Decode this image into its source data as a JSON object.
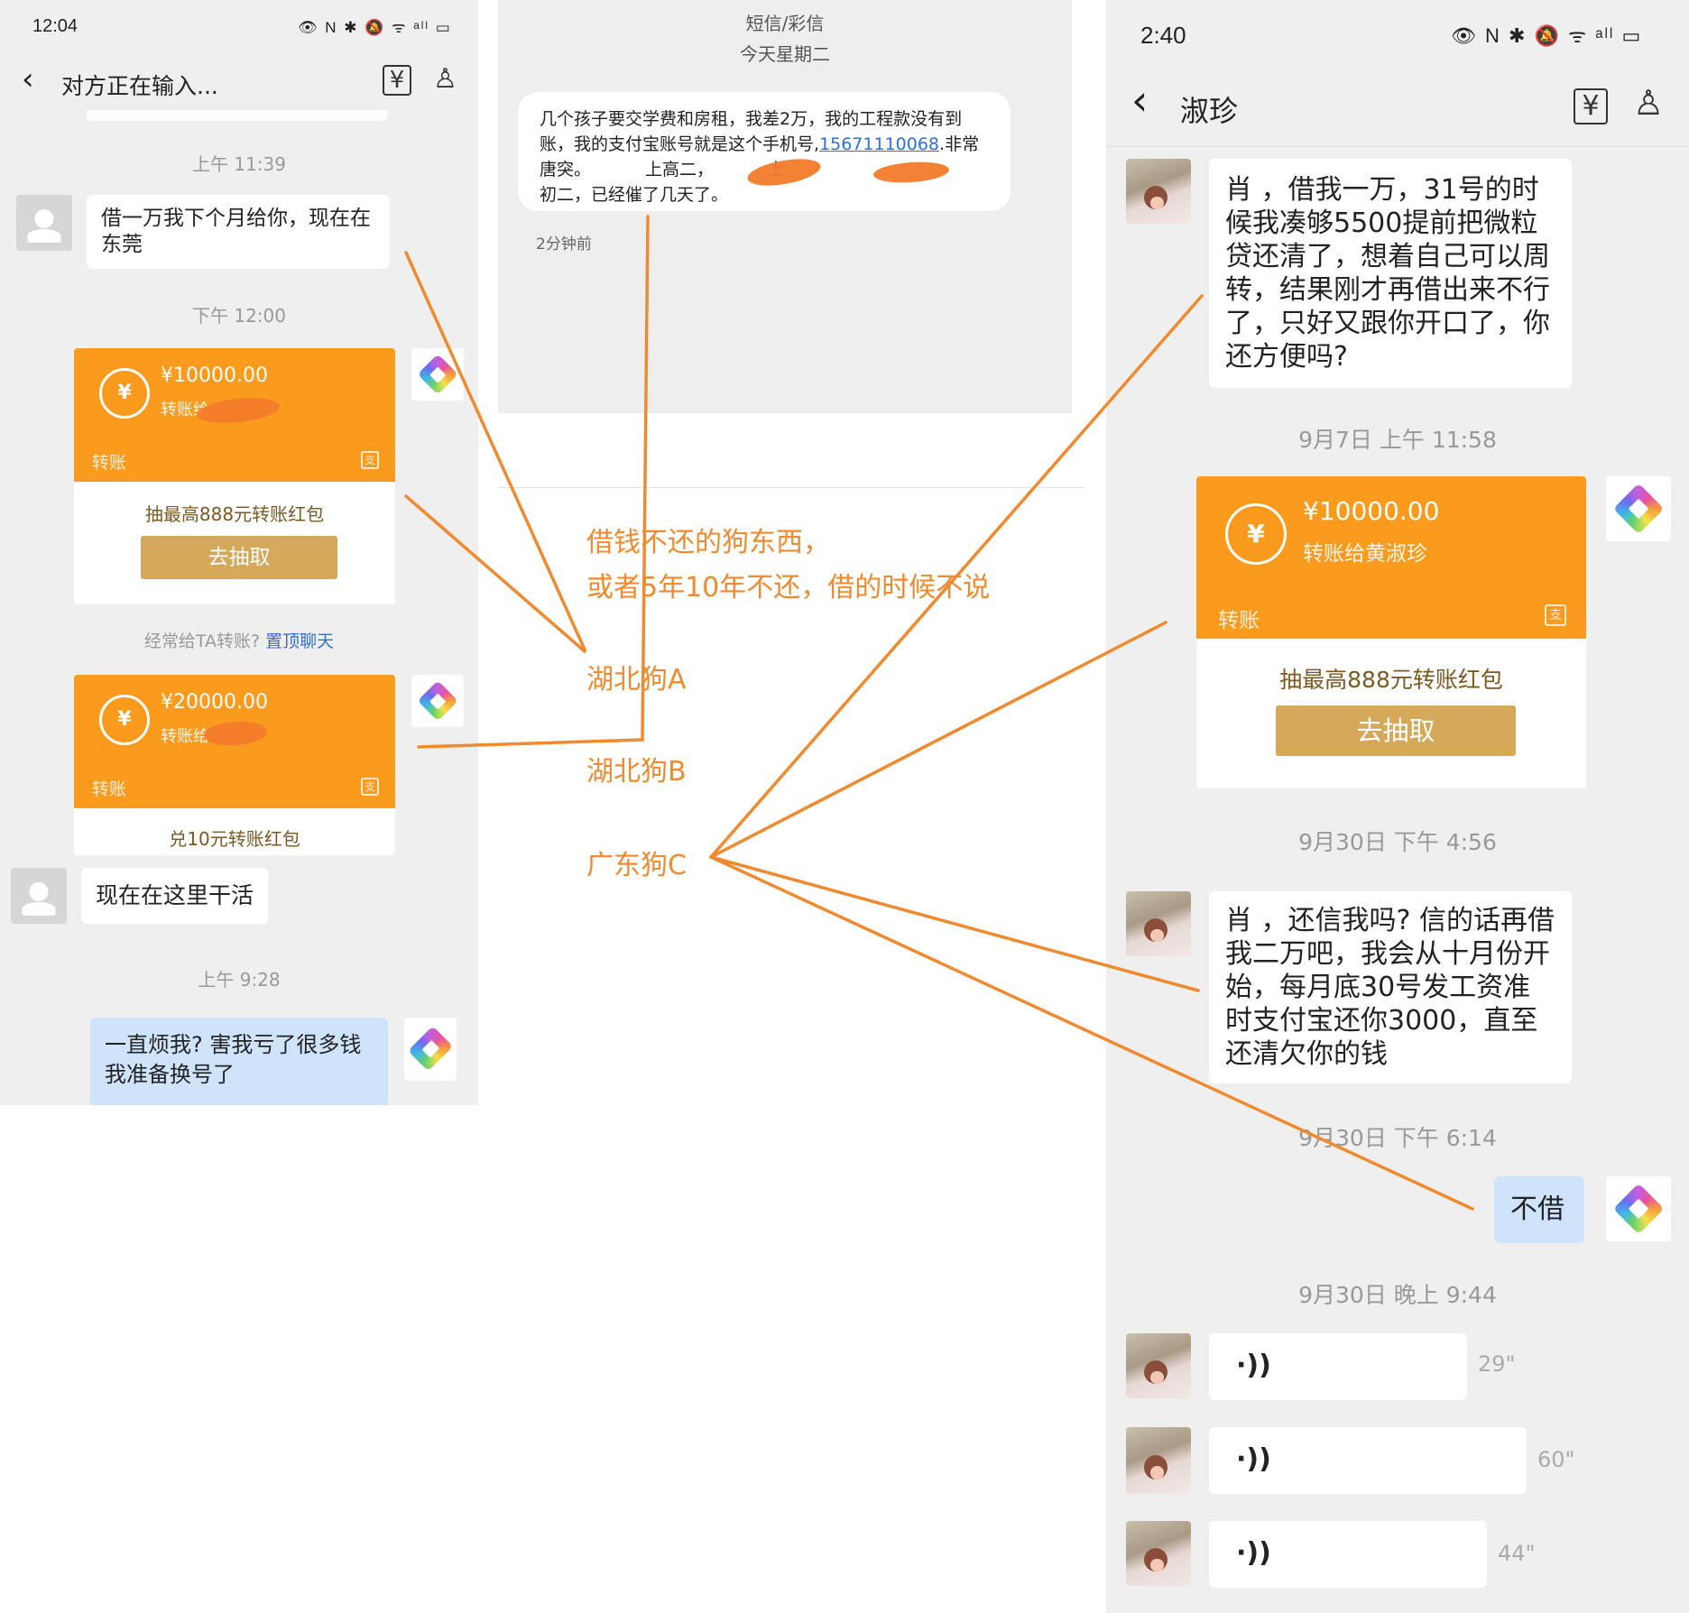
{
  "left": {
    "status_time": "12:04",
    "status_icons": "👁 N ✱ 🔕 ᯤ ᵃˡˡ ▭",
    "nav_title": "对方正在输入...",
    "ts1": "上午 11:39",
    "msg1": "借一万我下个月给你，现在在东莞",
    "ts2": "下午 12:00",
    "transfer1": {
      "amount": "¥10000.00",
      "to": "转账给",
      "kind": "转账",
      "promo": "抽最高888元转账红包",
      "button": "去抽取"
    },
    "hint_text": "经常给TA转账?",
    "hint_link": "置顶聊天",
    "transfer2": {
      "amount": "¥20000.00",
      "to": "转账给",
      "kind": "转账",
      "promo": "兑10元转账红包"
    },
    "msg2": "现在在这里干活",
    "ts3": "上午 9:28",
    "msg3": "一直烦我? 害我亏了很多钱我准备换号了"
  },
  "sms": {
    "header_title": "短信/彩信",
    "header_date": "今天星期二",
    "body_before_link": "几个孩子要交学费和房租，我差2万，我的工程款没有到账，我的支付宝账号就是这个手机号,",
    "phone": "15671110068",
    "body_after_link": ".非常唐突。",
    "body_frag1": "上高二，",
    "body_frag2": "上",
    "body_end": "初二，已经催了几天了。",
    "time_ago": "2分钟前"
  },
  "annotations": {
    "line1": "借钱不还的狗东西，",
    "line2": "或者5年10年不还，借的时候不说",
    "dog_a": "湖北狗A",
    "dog_b": "湖北狗B",
    "dog_c": "广东狗C"
  },
  "right": {
    "status_time": "2:40",
    "status_icons": "👁 N ✱ 🔕 ᯤ ᵃˡˡ ▭",
    "nav_title": "淑珍",
    "msg1": "肖  ，借我一万，31号的时候我凑够5500提前把微粒贷还清了，想着自己可以周转，结果刚才再借出来不行了，只好又跟你开口了，你还方便吗?",
    "ts1": "9月7日 上午 11:58",
    "transfer": {
      "amount": "¥10000.00",
      "to": "转账给黄淑珍",
      "kind": "转账",
      "promo": "抽最高888元转账红包",
      "button": "去抽取"
    },
    "ts2": "9月30日 下午 4:56",
    "msg2": "肖  ，还信我吗? 信的话再借我二万吧，我会从十月份开始，每月底30号发工资准时支付宝还你3000，直至还清欠你的钱",
    "ts3": "9月30日 下午 6:14",
    "msg3": "不借",
    "ts4": "9月30日 晚上 9:44",
    "voices": [
      "29\"",
      "60\"",
      "44\""
    ]
  },
  "colors": {
    "accent_orange": "#f08a2e",
    "transfer_orange": "#fa9b1e",
    "draw_button": "#d5a85a",
    "link_blue": "#2f6fd6"
  }
}
